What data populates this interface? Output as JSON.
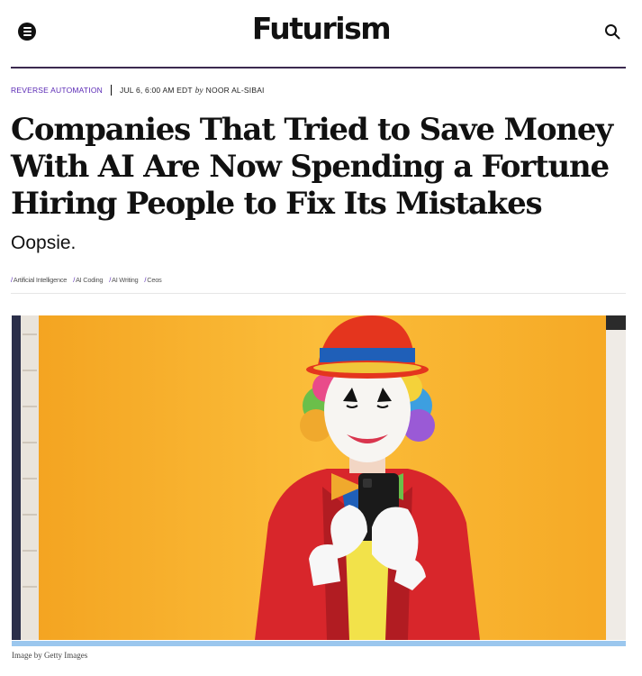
{
  "site": {
    "logo": "Futurism",
    "menu_icon": "hamburger-menu-icon",
    "search_icon": "search-icon"
  },
  "article": {
    "category": "REVERSE AUTOMATION",
    "date": "JUL 6, 6:00 AM EDT",
    "by": "by",
    "author": "NOOR AL-SIBAI",
    "headline_lines": [
      "Companies That Tried to Save Money",
      "With AI Are Now Spending a Fortune",
      "Hiring People to Fix Its Mistakes"
    ],
    "subhead": "Oopsie.",
    "tags": [
      "Artificial Intelligence",
      "AI Coding",
      "AI Writing",
      "Ceos"
    ],
    "image_credit": "Image by Getty Images"
  },
  "colors": {
    "accent": "#5b2ab5",
    "rule": "#3b2a4f",
    "hero_background": "#f6ae2a",
    "image_bar": "#9bc7ee"
  }
}
